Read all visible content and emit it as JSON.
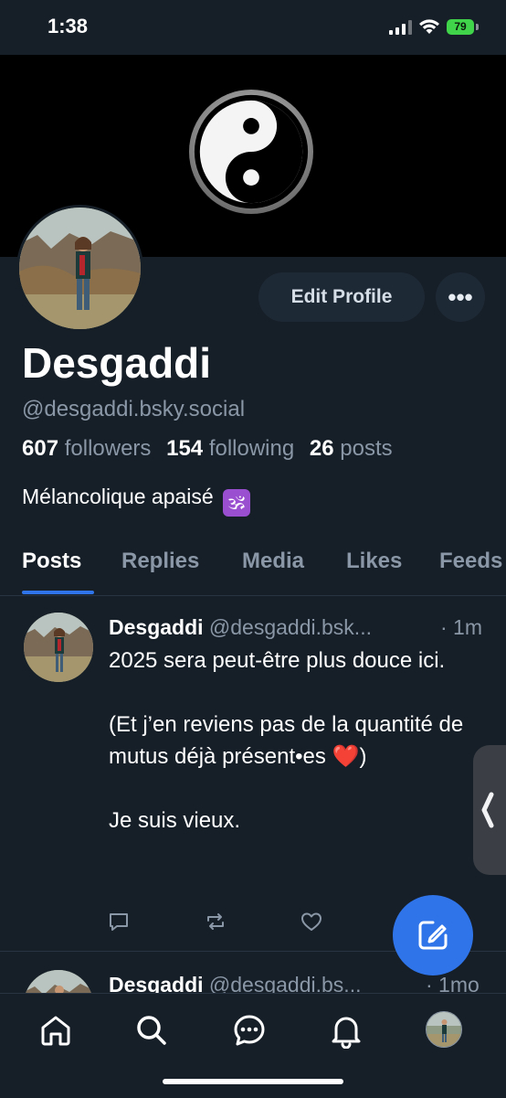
{
  "status_bar": {
    "time": "1:38",
    "battery": "79"
  },
  "profile": {
    "display_name": "Desgaddi",
    "handle": "@desgaddi.bsky.social",
    "followers_count": "607",
    "followers_label": "followers",
    "following_count": "154",
    "following_label": "following",
    "posts_count": "26",
    "posts_label": "posts",
    "bio": "Mélancolique apaisé",
    "bio_emoji": "🕉",
    "edit_button_label": "Edit Profile",
    "more_button_label": "•••"
  },
  "tabs": [
    {
      "label": "Posts",
      "active": true
    },
    {
      "label": "Replies",
      "active": false
    },
    {
      "label": "Media",
      "active": false
    },
    {
      "label": "Likes",
      "active": false
    },
    {
      "label": "Feeds",
      "active": false
    }
  ],
  "posts": [
    {
      "author": "Desgaddi",
      "handle": "@desgaddi.bsk...",
      "time": "· 1m",
      "text_1": "2025 sera peut-être plus douce ici.\n\n(Et j’en reviens pas de la quantité de mutus déjà présent•es ",
      "emoji": "❤️",
      "text_2": ")\n\nJe suis vieux."
    },
    {
      "author": "Desgaddi",
      "handle": "@desgaddi.bs...",
      "time": "· 1mo"
    }
  ],
  "icons": {
    "banner": "yin-yang-icon",
    "reply": "reply-icon",
    "repost": "repost-icon",
    "like": "heart-icon",
    "compose": "compose-icon",
    "nav": [
      "home-icon",
      "search-icon",
      "chat-icon",
      "bell-icon",
      "profile-avatar"
    ]
  },
  "colors": {
    "background": "#161e27",
    "accent": "#2f74e8",
    "muted_text": "#8a97a6",
    "battery": "#3fd44a"
  }
}
